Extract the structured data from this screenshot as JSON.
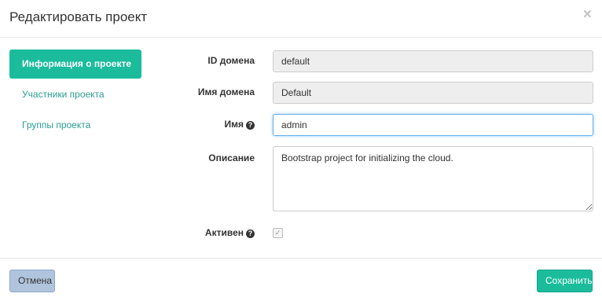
{
  "modal": {
    "title": "Редактировать проект",
    "close_symbol": "×"
  },
  "sidebar": {
    "items": [
      {
        "label": "Информация о проекте",
        "active": true
      },
      {
        "label": "Участники проекта",
        "active": false
      },
      {
        "label": "Группы проекта",
        "active": false
      }
    ]
  },
  "form": {
    "domain_id": {
      "label": "ID домена",
      "value": "default"
    },
    "domain_name": {
      "label": "Имя домена",
      "value": "Default"
    },
    "name": {
      "label": "Имя",
      "value": "admin",
      "help_icon": "question-circle-icon"
    },
    "description": {
      "label": "Описание",
      "value": "Bootstrap project for initializing the cloud."
    },
    "enabled": {
      "label": "Активен",
      "checked": true,
      "help_icon": "question-circle-icon"
    }
  },
  "footer": {
    "cancel_label": "Отмена",
    "save_label": "Сохранить"
  },
  "colors": {
    "accent": "#1abc9c",
    "link": "#2a9d8f",
    "cancel_button": "#b0c4de",
    "readonly_field": "#eeeeee"
  }
}
